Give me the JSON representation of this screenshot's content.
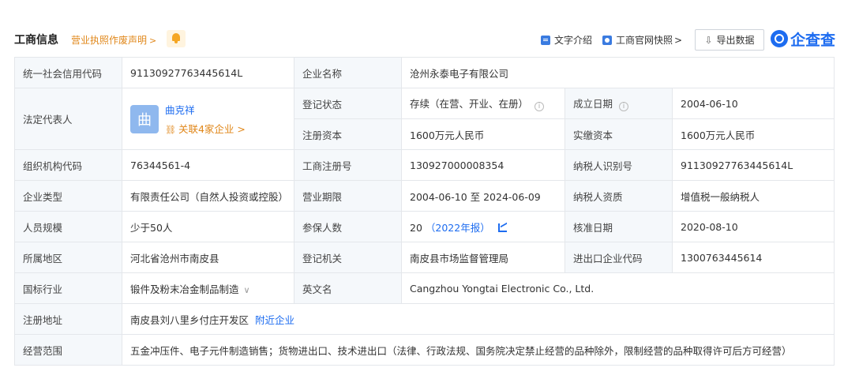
{
  "header": {
    "title": "工商信息",
    "notice_label": "营业执照作废声明",
    "notice_chevron": ">",
    "tool_doc_label": "文字介绍",
    "tool_snapshot_label": "工商官网快照",
    "tool_snapshot_chevron": ">",
    "export_label": "导出数据",
    "logo_text": "企查查"
  },
  "rows": {
    "credit_code_label": "统一社会信用代码",
    "credit_code_value": "91130927763445614L",
    "company_name_label": "企业名称",
    "company_name_value": "沧州永泰电子有限公司",
    "legal_rep_label": "法定代表人",
    "legal_rep_avatar": "曲",
    "legal_rep_name": "曲克祥",
    "legal_rep_related": "关联4家企业 >",
    "reg_status_label": "登记状态",
    "reg_status_value": "存续（在营、开业、在册）",
    "founded_label": "成立日期",
    "founded_value": "2004-06-10",
    "reg_capital_label": "注册资本",
    "reg_capital_value": "1600万元人民币",
    "paid_capital_label": "实缴资本",
    "paid_capital_value": "1600万元人民币",
    "org_code_label": "组织机构代码",
    "org_code_value": "76344561-4",
    "reg_no_label": "工商注册号",
    "reg_no_value": "130927000008354",
    "taxpayer_id_label": "纳税人识别号",
    "taxpayer_id_value": "91130927763445614L",
    "type_label": "企业类型",
    "type_value": "有限责任公司（自然人投资或控股）",
    "term_label": "营业期限",
    "term_value": "2004-06-10 至 2024-06-09",
    "taxpayer_qual_label": "纳税人资质",
    "taxpayer_qual_value": "增值税一般纳税人",
    "staff_label": "人员规模",
    "staff_value": "少于50人",
    "insured_label": "参保人数",
    "insured_value": "20",
    "insured_report": "（2022年报）",
    "approved_label": "核准日期",
    "approved_value": "2020-08-10",
    "region_label": "所属地区",
    "region_value": "河北省沧州市南皮县",
    "authority_label": "登记机关",
    "authority_value": "南皮县市场监督管理局",
    "ie_code_label": "进出口企业代码",
    "ie_code_value": "1300763445614",
    "industry_label": "国标行业",
    "industry_value": "锻件及粉末冶金制品制造",
    "en_name_label": "英文名",
    "en_name_value": "Cangzhou Yongtai Electronic Co., Ltd.",
    "address_label": "注册地址",
    "address_value": "南皮县刘八里乡付庄开发区",
    "address_link": "附近企业",
    "scope_label": "经营范围",
    "scope_value": "五金冲压件、电子元件制造销售；货物进出口、技术进出口（法律、行政法规、国务院决定禁止经营的品种除外，限制经营的品种取得许可后方可经营）"
  },
  "colors": {
    "accent": "#1d6cf0",
    "warning": "#e0871a",
    "label_bg": "#f5f8fb",
    "border": "#e4e7eb"
  }
}
